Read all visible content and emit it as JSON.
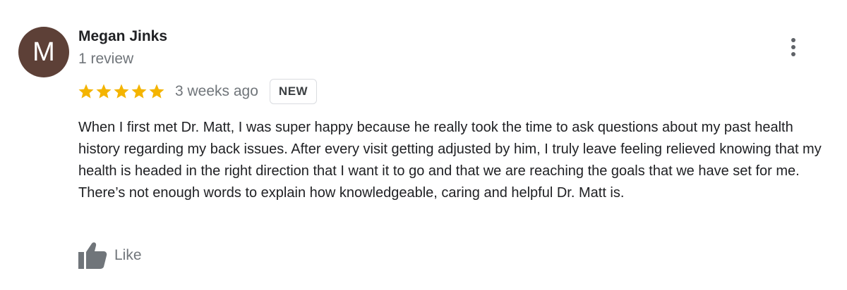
{
  "review": {
    "author": {
      "initial": "M",
      "name": "Megan Jinks",
      "review_count": "1 review",
      "avatar_color": "#5d4037"
    },
    "rating": 5,
    "rating_max": 5,
    "star_color": "#f4b400",
    "time_ago": "3 weeks ago",
    "badge": "NEW",
    "text": "When I first met Dr. Matt, I was super happy because he really took the time to ask questions about my past health history regarding my back issues. After every visit getting adjusted by him, I truly leave feeling relieved knowing that my health is headed in the right direction that I want it to go and that we are reaching the goals that we have set for me. There’s not enough words to explain how knowledgeable, caring and helpful Dr. Matt is.",
    "actions": {
      "like_label": "Like",
      "like_icon": "thumbs-up-icon",
      "more_icon": "more-vert-icon"
    }
  }
}
